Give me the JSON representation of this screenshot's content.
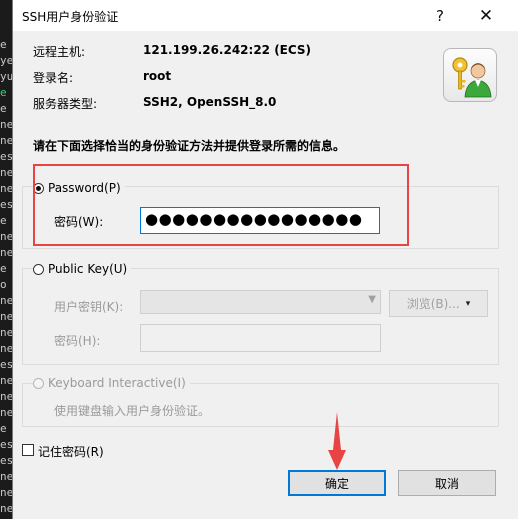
{
  "terminal": {
    "fragments": [
      "e",
      "ye",
      "yu",
      "e",
      "e",
      "ne",
      "ne",
      "es",
      "ne",
      "ne",
      "es",
      "e",
      "ne",
      "ne",
      "e",
      "o",
      "ne",
      "ne",
      "ne",
      "ne",
      "es",
      "ne",
      "ne",
      "ne",
      "e",
      "es",
      "es",
      "ne",
      "ne",
      "ne",
      "ne"
    ]
  },
  "dialog": {
    "title": "SSH用户身份验证",
    "help_glyph": "?",
    "close_glyph": "✕",
    "info": {
      "host_label": "远程主机:",
      "host_value": "121.199.26.242:22 (ECS)",
      "login_label": "登录名:",
      "login_value": "root",
      "server_label": "服务器类型:",
      "server_value": "SSH2, OpenSSH_8.0"
    },
    "instruction": "请在下面选择恰当的身份验证方法并提供登录所需的信息。",
    "password": {
      "option_label": "Password(P)",
      "field_label": "密码(W):",
      "value": "●●●●●●●●●●●●●●●●",
      "selected": true
    },
    "public_key": {
      "option_label": "Public Key(U)",
      "user_key_label": "用户密钥(K):",
      "browse_label": "浏览(B)...",
      "dropdown_glyph": "▾",
      "key_password_label": "密码(H):",
      "selected": false
    },
    "keyboard": {
      "option_label": "Keyboard Interactive(I)",
      "description": "使用键盘输入用户身份验证。"
    },
    "remember_label": "记住密码(R)",
    "ok_label": "确定",
    "cancel_label": "取消"
  },
  "colors": {
    "annotation_red": "#e84444",
    "focus_blue": "#0078d7"
  }
}
